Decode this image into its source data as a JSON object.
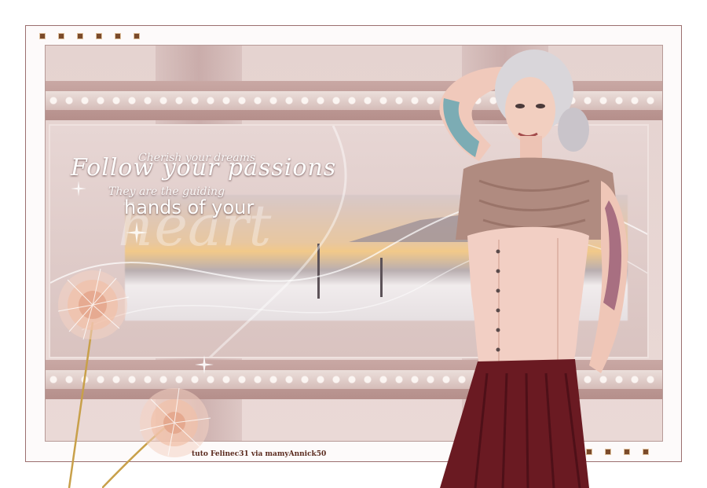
{
  "image": {
    "description_labels": {
      "quote_line1": "Cherish your dreams",
      "quote_line2": "Follow your passions",
      "quote_line3": "They are the guiding",
      "quote_line4": "hands of your",
      "quote_line5": "heart"
    },
    "credit": "tuto Felinec31 via mamyAnnick50"
  },
  "colors": {
    "frame": "#9b6f6f",
    "panel": "#e5d3d0",
    "band": "#b58f8b",
    "corset": "#f2cfc4",
    "skirt": "#6a1a22",
    "blouse": "#b08b80",
    "credit_text": "#5a2a1e"
  },
  "icons": [
    "dandelion-icon",
    "sparkle-icon",
    "dot-ornament-icon"
  ]
}
